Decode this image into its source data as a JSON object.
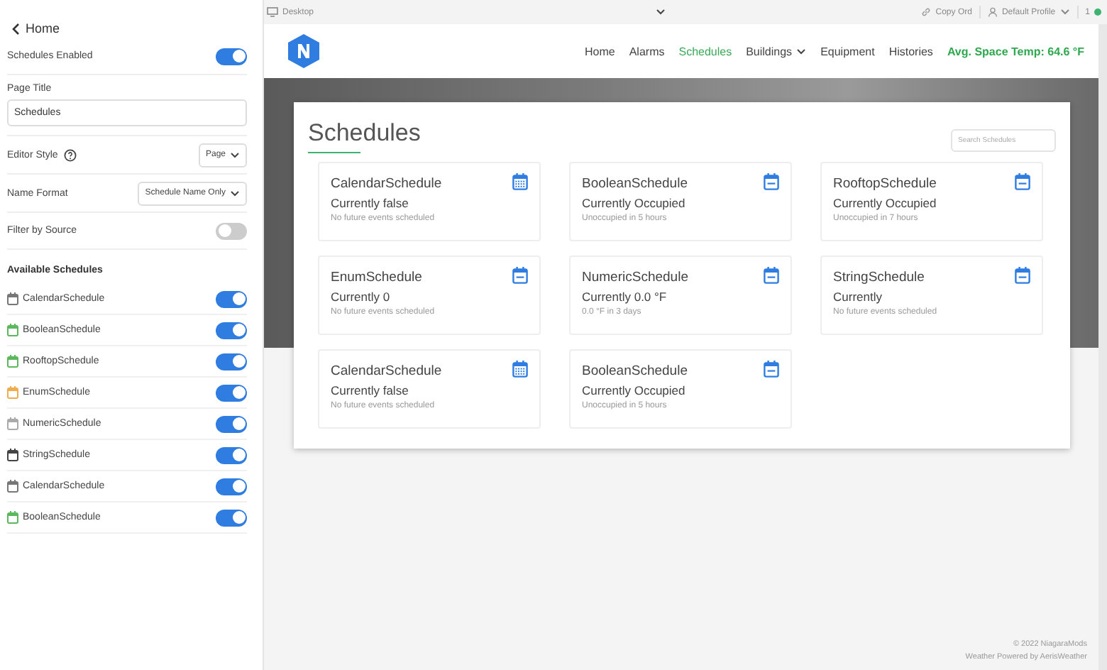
{
  "sidebar": {
    "back": "Home",
    "settings": [
      {
        "kind": "toggle",
        "label": "Schedules Enabled",
        "on": true
      },
      {
        "kind": "text",
        "label": "Page Title",
        "value": "Schedules"
      },
      {
        "kind": "select",
        "label": "Editor Style",
        "help": true,
        "value": "Page"
      },
      {
        "kind": "select",
        "label": "Name Format",
        "help": false,
        "value": "Schedule Name Only"
      },
      {
        "kind": "toggle",
        "label": "Filter by Source",
        "on": false
      }
    ],
    "section_title": "Available Schedules",
    "schedules": [
      {
        "name": "CalendarSchedule",
        "color": "#777777",
        "on": true
      },
      {
        "name": "BooleanSchedule",
        "color": "#5cb85c",
        "on": true
      },
      {
        "name": "RooftopSchedule",
        "color": "#5cb85c",
        "on": true
      },
      {
        "name": "EnumSchedule",
        "color": "#f0ad4e",
        "on": true
      },
      {
        "name": "NumericSchedule",
        "color": "#aaaaaa",
        "on": true
      },
      {
        "name": "StringSchedule",
        "color": "#444444",
        "on": true
      },
      {
        "name": "CalendarSchedule",
        "color": "#777777",
        "on": true
      },
      {
        "name": "BooleanSchedule",
        "color": "#5cb85c",
        "on": true
      }
    ]
  },
  "toolbar": {
    "device": "Desktop",
    "copy": "Copy Ord",
    "profile": "Default Profile",
    "count": "1"
  },
  "nav": {
    "items": [
      {
        "label": "Home",
        "selected": false,
        "dropdown": false
      },
      {
        "label": "Alarms",
        "selected": false,
        "dropdown": false
      },
      {
        "label": "Schedules",
        "selected": true,
        "dropdown": false
      },
      {
        "label": "Buildings",
        "selected": false,
        "dropdown": true
      },
      {
        "label": "Equipment",
        "selected": false,
        "dropdown": false
      },
      {
        "label": "Histories",
        "selected": false,
        "dropdown": false
      }
    ],
    "temp": "Avg. Space Temp: 64.6 °F"
  },
  "page": {
    "title": "Schedules",
    "search_placeholder": "Search Schedules",
    "cards": [
      {
        "kind": "calendar",
        "name": "CalendarSchedule",
        "current": "Currently false",
        "next": "No future events scheduled"
      },
      {
        "kind": "weekly",
        "name": "BooleanSchedule",
        "current": "Currently Occupied",
        "next": "Unoccupied in 5 hours"
      },
      {
        "kind": "weekly",
        "name": "RooftopSchedule",
        "current": "Currently Occupied",
        "next": "Unoccupied in 7 hours"
      },
      {
        "kind": "weekly",
        "name": "EnumSchedule",
        "current": "Currently 0",
        "next": "No future events scheduled"
      },
      {
        "kind": "weekly",
        "name": "NumericSchedule",
        "current": "Currently 0.0 °F",
        "next": "0.0 °F in 3 days"
      },
      {
        "kind": "weekly",
        "name": "StringSchedule",
        "current": "Currently",
        "next": "No future events scheduled"
      },
      {
        "kind": "calendar",
        "name": "CalendarSchedule",
        "current": "Currently false",
        "next": "No future events scheduled"
      },
      {
        "kind": "weekly",
        "name": "BooleanSchedule",
        "current": "Currently Occupied",
        "next": "Unoccupied in 5 hours"
      }
    ]
  },
  "footer": {
    "copyright": "© 2022 NiagaraMods",
    "weather": "Weather Powered by AerisWeather"
  }
}
